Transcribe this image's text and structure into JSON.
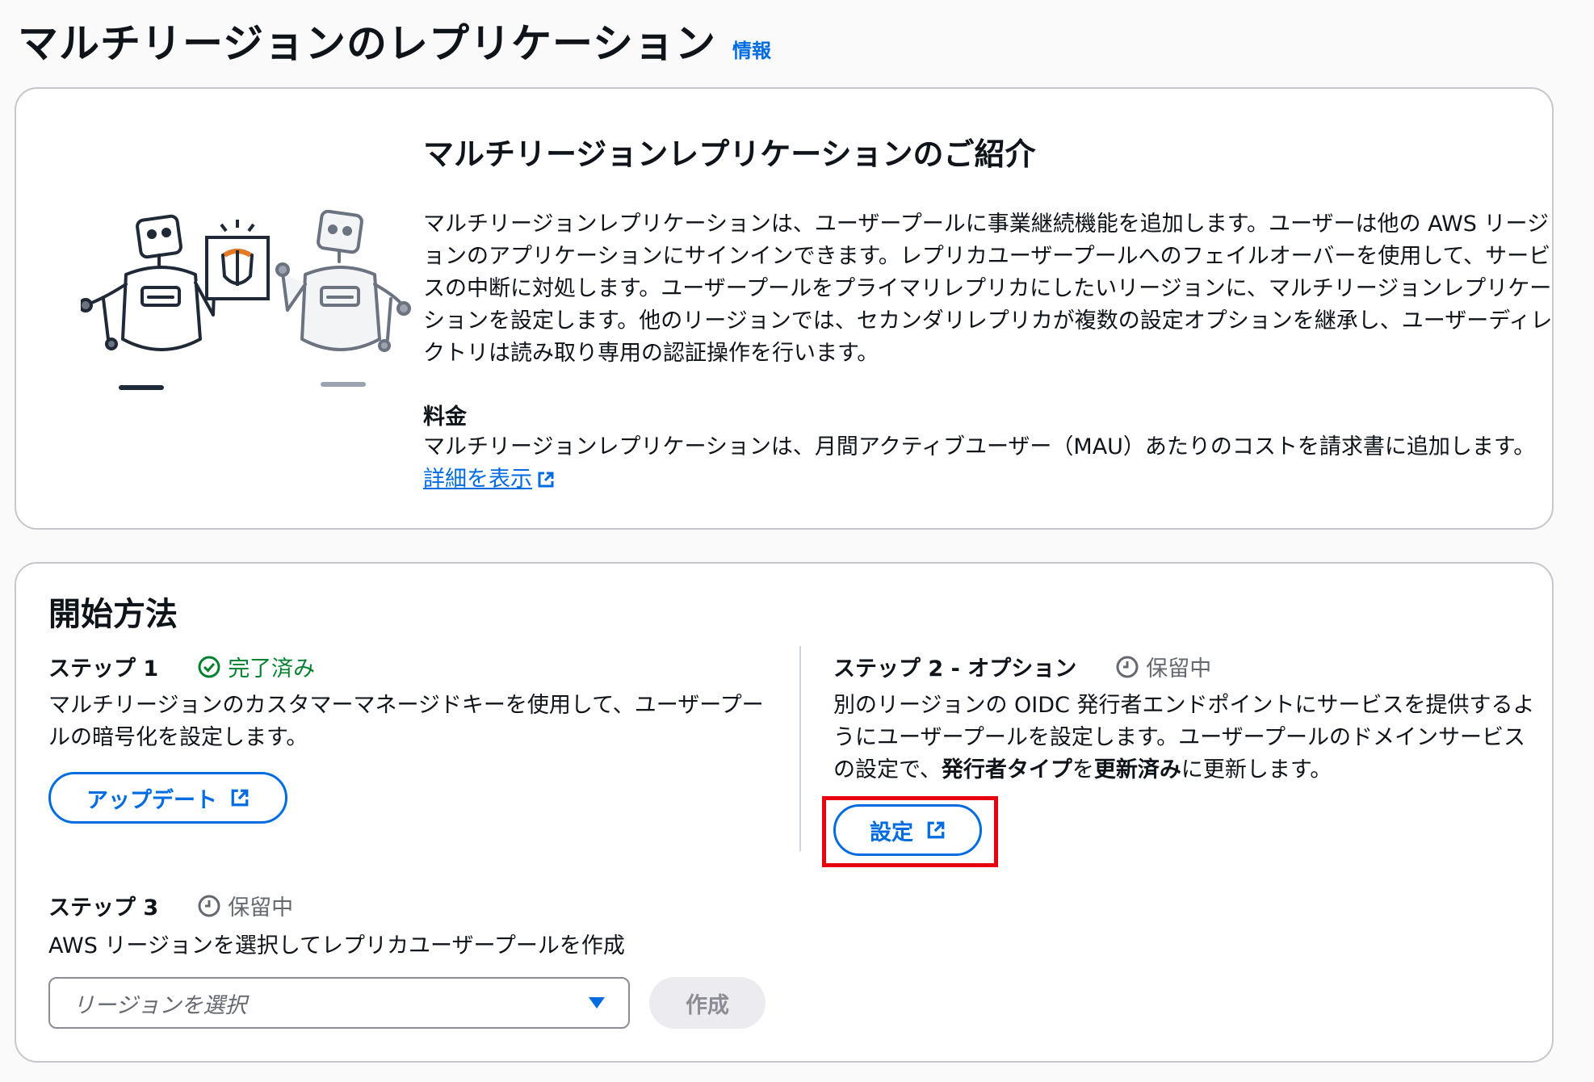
{
  "header": {
    "title": "マルチリージョンのレプリケーション",
    "info_link": "情報"
  },
  "intro": {
    "title": "マルチリージョンレプリケーションのご紹介",
    "body": "マルチリージョンレプリケーションは、ユーザープールに事業継続機能を追加します。ユーザーは他の AWS リージョンのアプリケーションにサインインできます。レプリカユーザープールへのフェイルオーバーを使用して、サービスの中断に対処します。ユーザープールをプライマリレプリカにしたいリージョンに、マルチリージョンレプリケーションを設定します。他のリージョンでは、セカンダリレプリカが複数の設定オプションを継承し、ユーザーディレクトリは読み取り専用の認証操作を行います。",
    "pricing_title": "料金",
    "pricing_body": "マルチリージョンレプリケーションは、月間アクティブユーザー（MAU）あたりのコストを請求書に追加します。",
    "pricing_link": "詳細を表示"
  },
  "getting_started": {
    "title": "開始方法",
    "step1": {
      "label": "ステップ 1",
      "status": "完了済み",
      "text": "マルチリージョンのカスタマーマネージドキーを使用して、ユーザープールの暗号化を設定します。",
      "button": "アップデート"
    },
    "step2": {
      "label": "ステップ 2 - オプション",
      "status": "保留中",
      "text_before": "別のリージョンの OIDC 発行者エンドポイントにサービスを提供するようにユーザープールを設定します。ユーザープールのドメインサービスの設定で、",
      "bold1": "発行者タイプ",
      "text_mid": "を",
      "bold2": "更新済み",
      "text_after": "に更新します。",
      "button": "設定"
    },
    "step3": {
      "label": "ステップ 3",
      "status": "保留中",
      "text": "AWS リージョンを選択してレプリカユーザープールを作成",
      "select_placeholder": "リージョンを選択",
      "create_button": "作成"
    }
  },
  "colors": {
    "link": "#006ce0",
    "success": "#00802f",
    "pending": "#656871",
    "highlight": "#e8000f"
  }
}
